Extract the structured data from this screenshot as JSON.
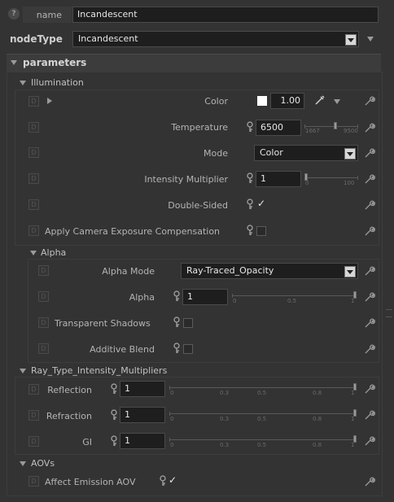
{
  "header": {
    "name_label": "name",
    "name_value": "Incandescent",
    "nodetype_label": "nodeType",
    "nodetype_value": "Incandescent"
  },
  "parameters": {
    "title": "parameters",
    "illumination": {
      "title": "Illumination",
      "color": {
        "label": "Color",
        "value": "1.00",
        "swatch": "#ffffff"
      },
      "temperature": {
        "label": "Temperature",
        "value": "6500",
        "min_tick": "1667",
        "max_tick": "9500",
        "level": 0.62
      },
      "mode": {
        "label": "Mode",
        "value": "Color"
      },
      "intensity": {
        "label": "Intensity Multiplier",
        "value": "1",
        "min_tick": "0",
        "max_tick": "100",
        "level": 0.0
      },
      "double_sided": {
        "label": "Double-Sided",
        "checked": true
      },
      "exposure": {
        "label": "Apply Camera Exposure Compensation",
        "checked": false
      }
    },
    "alpha": {
      "title": "Alpha",
      "mode": {
        "label": "Alpha Mode",
        "value": "Ray-Traced_Opacity"
      },
      "alpha": {
        "label": "Alpha",
        "value": "1",
        "ticks": [
          "0",
          "0.5",
          "1"
        ],
        "level": 1.0
      },
      "transparent_shadows": {
        "label": "Transparent Shadows",
        "checked": false
      },
      "additive_blend": {
        "label": "Additive Blend",
        "checked": false
      }
    },
    "ray_type": {
      "title": "Ray_Type_Intensity_Multipliers",
      "ticks": [
        "0",
        "0.3",
        "0.5",
        "0.8",
        "1"
      ],
      "reflection": {
        "label": "Reflection",
        "value": "1",
        "level": 1.0
      },
      "refraction": {
        "label": "Refraction",
        "value": "1",
        "level": 1.0
      },
      "gi": {
        "label": "GI",
        "value": "1",
        "level": 1.0
      }
    },
    "aovs": {
      "title": "AOVs",
      "affect_emission": {
        "label": "Affect Emission AOV",
        "checked": true
      }
    }
  },
  "icons": {
    "help": "question-icon",
    "wrench": "wrench-icon",
    "key": "key-icon",
    "dropper": "eyedropper-icon",
    "d": "D"
  }
}
